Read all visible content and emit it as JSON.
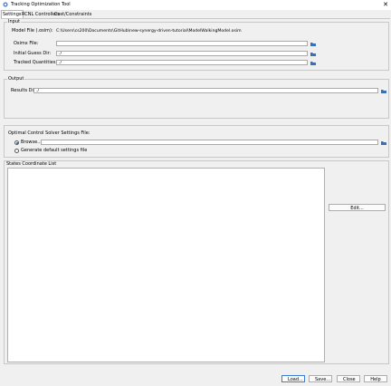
{
  "window": {
    "title": "Tracking Optimization Tool",
    "close_glyph": "✕"
  },
  "tabs": [
    {
      "label": "Settings",
      "active": true
    },
    {
      "label": "RCNL Controllers",
      "active": false
    },
    {
      "label": "Cost/Constraints",
      "active": false
    }
  ],
  "input": {
    "title": "Input",
    "model_file_label": "Model File (.osim):",
    "model_file_value": "C:\\Users\\cs200\\Documents\\GitHub\\new-synergy-driven-tutorial\\ModelWalkingModel.osim",
    "osimx_label": "Osimx File:",
    "osimx_value": "",
    "initial_guess_label": "Initial Guess Dir:",
    "initial_guess_value": "./",
    "tracked_label": "Tracked Quantities Dir:",
    "tracked_value": "./"
  },
  "output": {
    "title": "Output",
    "results_label": "Results Dir:",
    "results_value": "./"
  },
  "solver": {
    "title": "Optimal Control Solver Settings File:",
    "browse_label": "Browse...",
    "browse_selected": true,
    "browse_value": "",
    "generate_label": "Generate default settings file"
  },
  "states": {
    "title": "States Coordinate List",
    "edit_label": "Edit..."
  },
  "footer": {
    "load_label": "Load...",
    "save_label": "Save...",
    "close_label": "Close",
    "help_label": "Help"
  },
  "icons": {
    "app": "opensim-app-icon",
    "folder": "folder-icon",
    "close": "close-icon"
  },
  "colors": {
    "folder": "#3b6fb6",
    "accent": "#3a7bd5"
  }
}
